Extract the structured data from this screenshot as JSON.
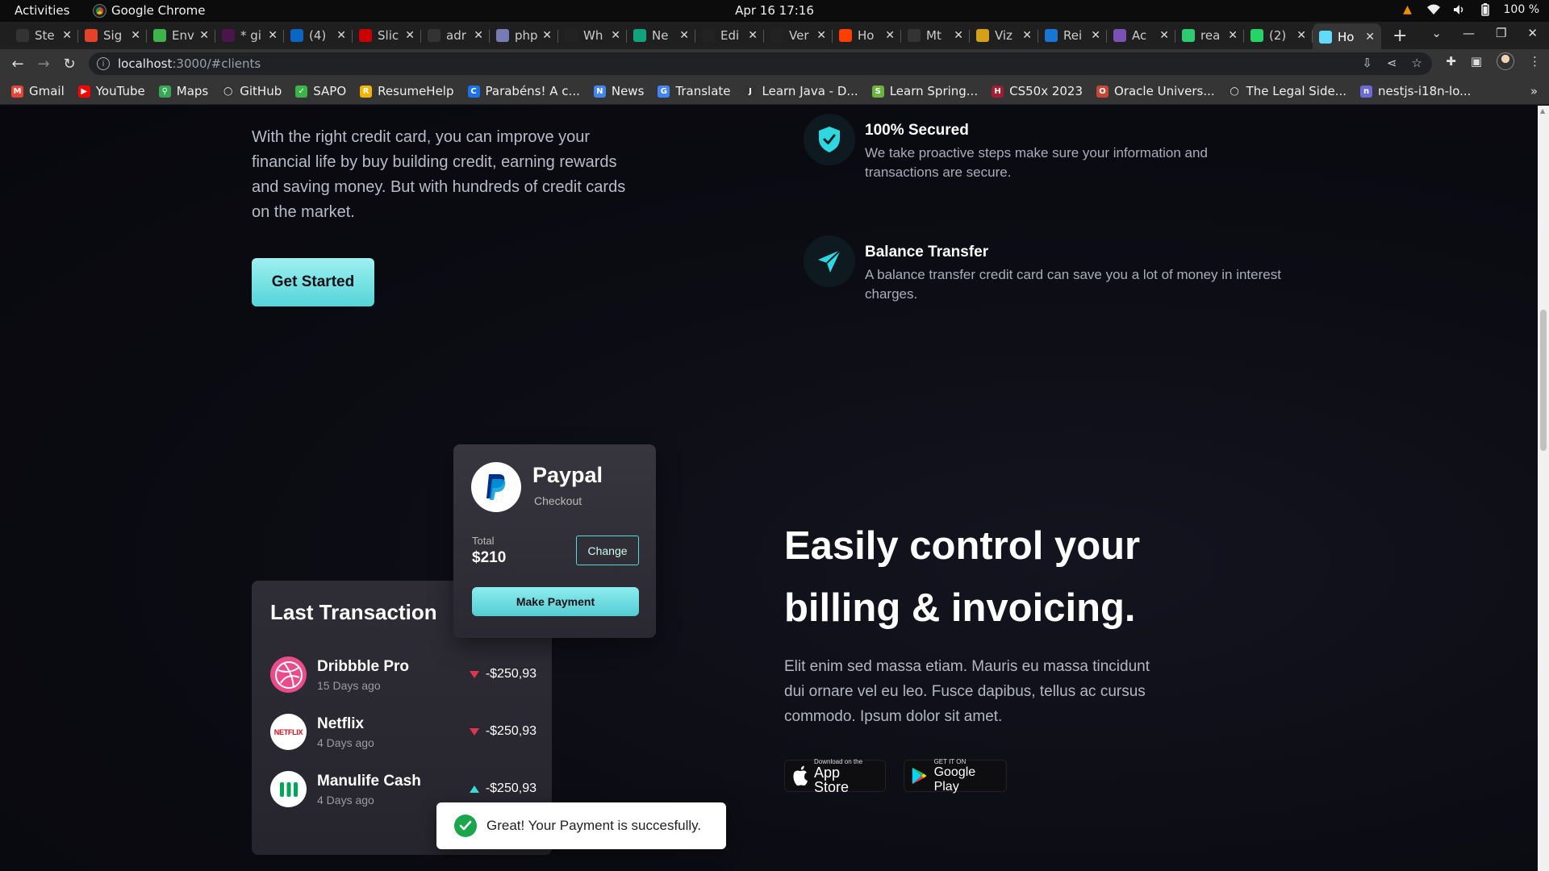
{
  "system": {
    "activities": "Activities",
    "app_name": "Google Chrome",
    "clock": "Apr 16  17:16",
    "battery": "100 %"
  },
  "tabs": [
    {
      "label": "Ste",
      "color": "#333"
    },
    {
      "label": "Sig",
      "color": "#e24329"
    },
    {
      "label": "Env",
      "color": "#3bb54a"
    },
    {
      "label": "* gi",
      "color": "#4a154b"
    },
    {
      "label": "(4)",
      "color": "#0a66c2"
    },
    {
      "label": "Slic",
      "color": "#c00"
    },
    {
      "label": "adr",
      "color": "#333"
    },
    {
      "label": "php",
      "color": "#777bb3"
    },
    {
      "label": "Wh",
      "color": "#222"
    },
    {
      "label": "Ne",
      "color": "#10a37f"
    },
    {
      "label": "Edi",
      "color": "#222"
    },
    {
      "label": "Ver",
      "color": "#222"
    },
    {
      "label": "Ho",
      "color": "#ff3e00"
    },
    {
      "label": "Mt",
      "color": "#333"
    },
    {
      "label": "Viz",
      "color": "#d4a017"
    },
    {
      "label": "Rei",
      "color": "#1976d2"
    },
    {
      "label": "Ac",
      "color": "#7952b3"
    },
    {
      "label": "rea",
      "color": "#2ecc71"
    },
    {
      "label": "(2)",
      "color": "#25d366"
    },
    {
      "label": "Ho",
      "color": "#61dafb"
    }
  ],
  "address": {
    "host": "localhost",
    "path": ":3000/#clients"
  },
  "bookmarks": [
    {
      "label": "Gmail",
      "color": "#ea4335",
      "glyph": "M"
    },
    {
      "label": "YouTube",
      "color": "#ff0000",
      "glyph": "▶"
    },
    {
      "label": "Maps",
      "color": "#34a853",
      "glyph": "⚲"
    },
    {
      "label": "GitHub",
      "color": "#333",
      "glyph": "◯"
    },
    {
      "label": "SAPO",
      "color": "#3bb54a",
      "glyph": "✓"
    },
    {
      "label": "ResumeHelp",
      "color": "#f4b400",
      "glyph": "R"
    },
    {
      "label": "Parabéns! A c...",
      "color": "#1a73e8",
      "glyph": "C"
    },
    {
      "label": "News",
      "color": "#4285f4",
      "glyph": "N"
    },
    {
      "label": "Translate",
      "color": "#4285f4",
      "glyph": "G"
    },
    {
      "label": "Learn Java - D...",
      "color": "#333",
      "glyph": "J"
    },
    {
      "label": "Learn Spring...",
      "color": "#6db33f",
      "glyph": "S"
    },
    {
      "label": "CS50x 2023",
      "color": "#a51c30",
      "glyph": "H"
    },
    {
      "label": "Oracle Univers...",
      "color": "#c74634",
      "glyph": "O"
    },
    {
      "label": "The Legal Side...",
      "color": "#333",
      "glyph": "◯"
    },
    {
      "label": "nestjs-i18n-lo...",
      "color": "#6b6bd6",
      "glyph": "n"
    }
  ],
  "page": {
    "intro_text": "With the right credit card, you can improve your financial life by buy building credit, earning rewards and saving money. But with hundreds of credit cards on the market.",
    "cta_label": "Get Started",
    "features": [
      {
        "title": "100% Secured",
        "text": "We take proactive steps make sure your information and transactions are secure.",
        "icon": "shield-icon"
      },
      {
        "title": "Balance Transfer",
        "text": "A balance transfer credit card can save you a lot of money in interest charges.",
        "icon": "send-icon"
      }
    ],
    "transactions": {
      "title": "Last Transaction",
      "rows": [
        {
          "name": "Dribbble Pro",
          "when": "15 Days ago",
          "amount": "-$250,93",
          "direction": "down"
        },
        {
          "name": "Netflix",
          "when": "4 Days ago",
          "amount": "-$250,93",
          "direction": "down",
          "logo_text": "NETFLIX"
        },
        {
          "name": "Manulife Cash",
          "when": "4 Days ago",
          "amount": "-$250,93",
          "direction": "up"
        }
      ]
    },
    "paypal": {
      "title": "Paypal",
      "subtitle": "Checkout",
      "total_label": "Total",
      "total": "$210",
      "change_label": "Change",
      "pay_label": "Make Payment"
    },
    "hero_title": "Easily control your billing & invoicing.",
    "hero_text": "Elit enim sed massa etiam. Mauris eu massa tincidunt dui ornare vel eu leo. Fusce dapibus, tellus ac cursus commodo. Ipsum dolor sit amet.",
    "app_store": {
      "small": "Download on the",
      "big": "App Store"
    },
    "google_play": {
      "small": "GET IT ON",
      "big": "Google Play"
    },
    "toast": "Great! Your Payment is succesfully."
  }
}
